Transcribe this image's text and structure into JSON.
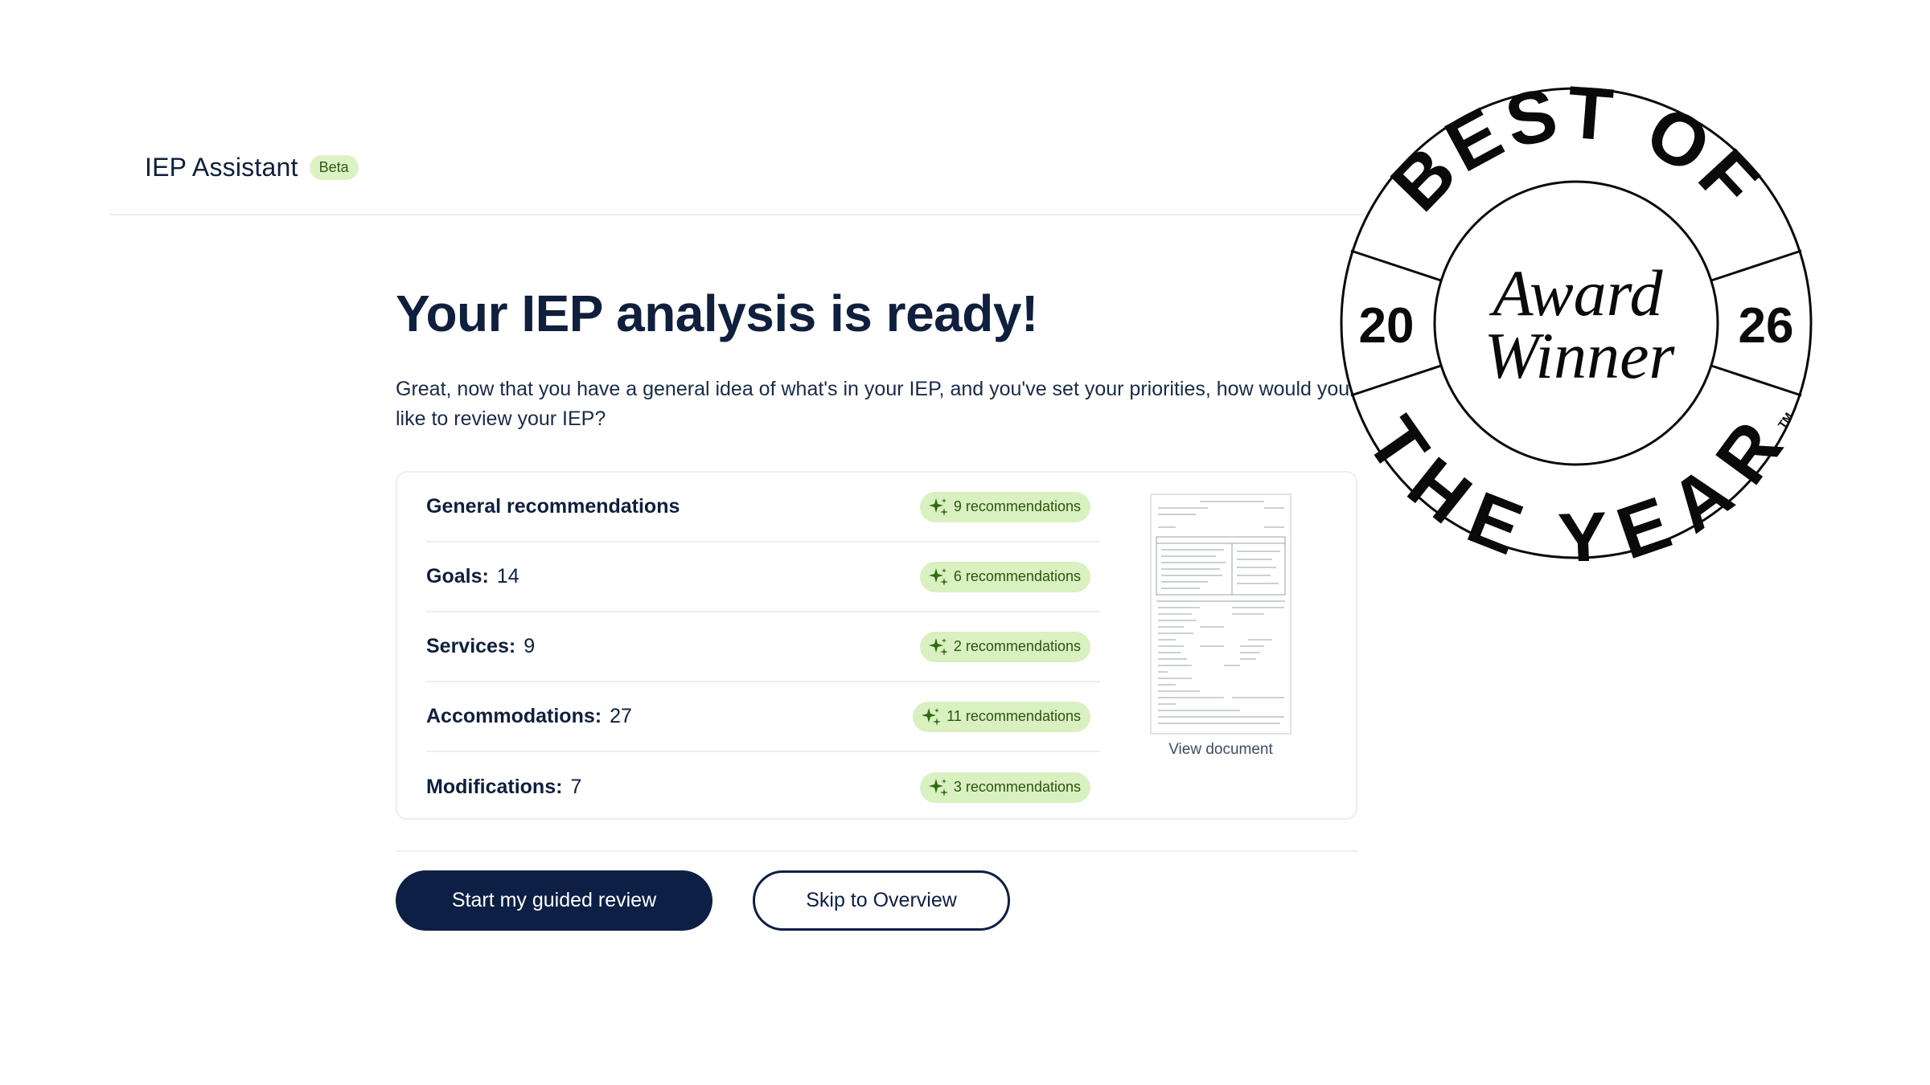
{
  "header": {
    "app_name": "IEP Assistant",
    "badge": "Beta"
  },
  "main": {
    "title": "Your IEP analysis is ready!",
    "intro": "Great, now that you have a general idea of what's in your IEP, and you've set your priorities, how would you like to review your IEP?",
    "rows": [
      {
        "label": "General recommendations",
        "count": "",
        "recommendations": "9 recommendations",
        "icon": "sparkle-icon"
      },
      {
        "label": "Goals:",
        "count": "14",
        "recommendations": "6 recommendations",
        "icon": "sparkle-icon"
      },
      {
        "label": "Services:",
        "count": "9",
        "recommendations": "2 recommendations",
        "icon": "sparkle-icon"
      },
      {
        "label": "Accommodations:",
        "count": "27",
        "recommendations": "11 recommendations",
        "icon": "sparkle-icon"
      },
      {
        "label": "Modifications:",
        "count": "7",
        "recommendations": "3 recommendations",
        "icon": "sparkle-icon"
      }
    ],
    "document": {
      "link_label": "View document"
    },
    "actions": {
      "primary_label": "Start my guided review",
      "secondary_label": "Skip to Overview"
    }
  },
  "award": {
    "top_arc": "BEST OF",
    "bottom_arc": "THE YEAR",
    "year_left": "20",
    "year_right": "26",
    "line1": "Award",
    "line2": "Winner",
    "trademark": "TM"
  },
  "colors": {
    "navy": "#0d1f44",
    "pill_bg": "#d9f0c0",
    "pill_text": "#2c5310",
    "badge_bg": "#dcf2c4",
    "sparkle": "#2f6b12"
  }
}
